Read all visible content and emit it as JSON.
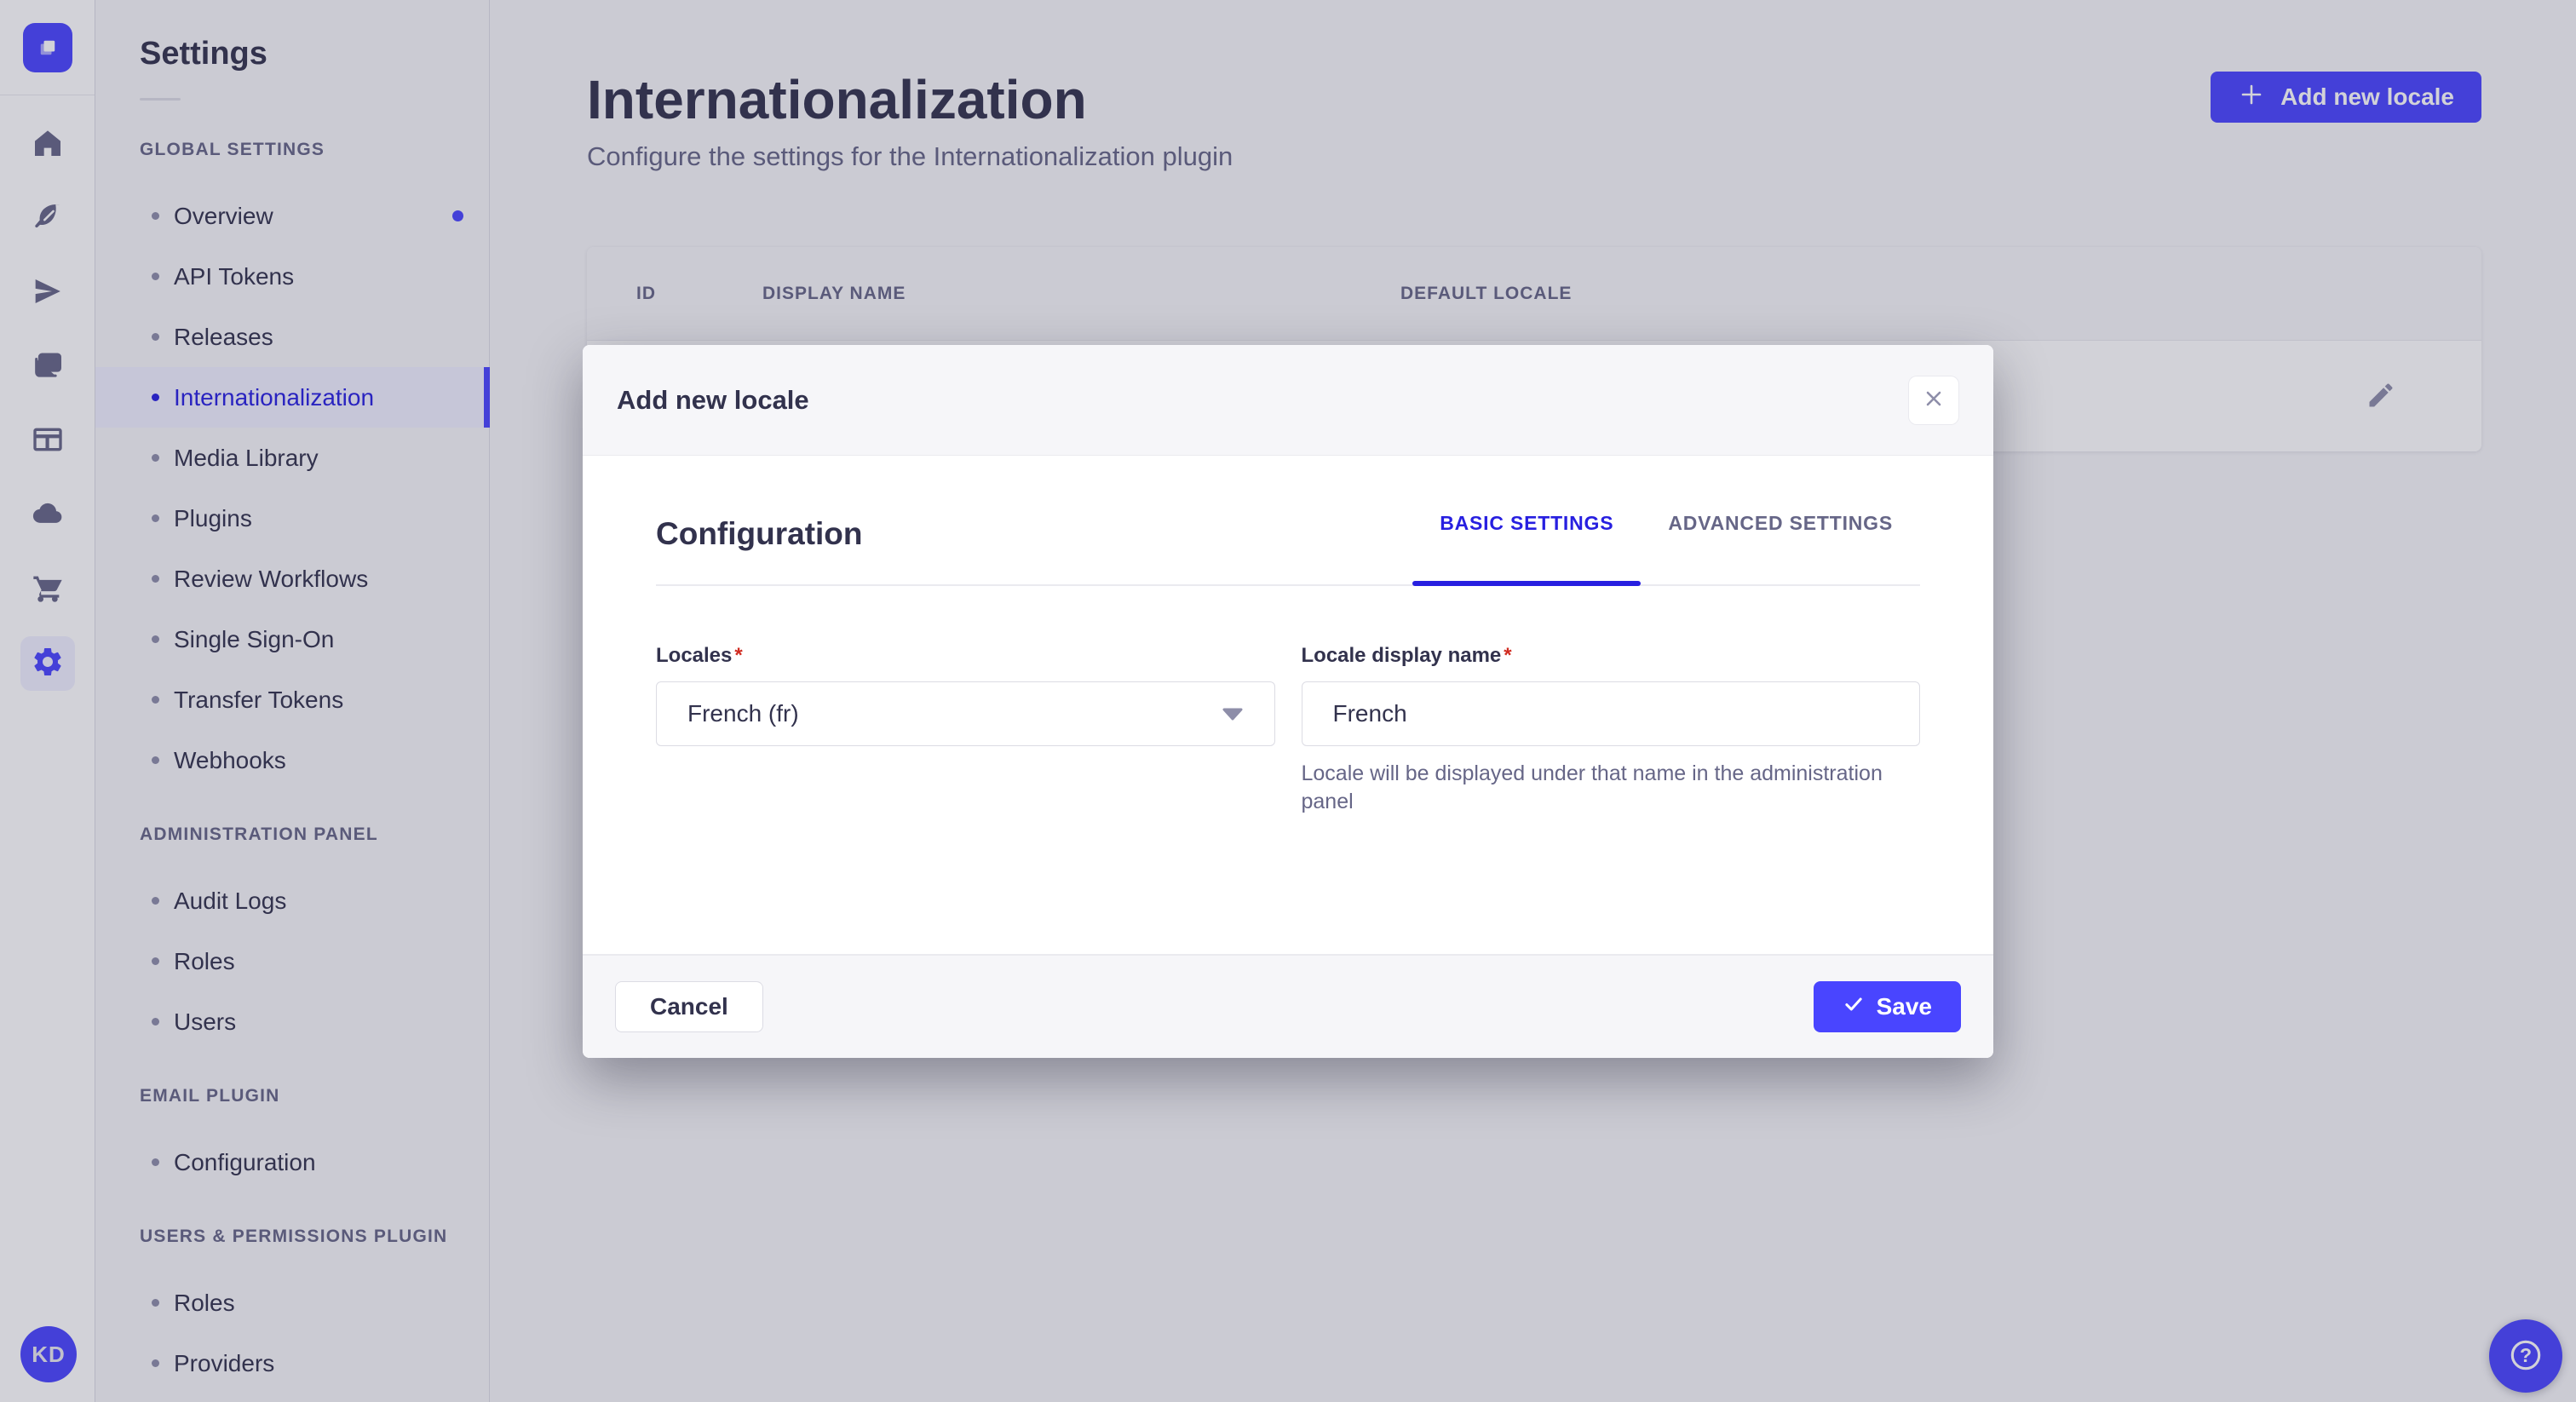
{
  "colors": {
    "primary": "#4945ff",
    "primary_dark": "#271fe0",
    "primary_light_bg": "#f0f0ff",
    "text": "#32324d",
    "text_muted": "#666687",
    "border": "#dcdce4",
    "border_light": "#eaeaef",
    "page_bg": "#f6f6f9",
    "danger": "#d02b20"
  },
  "rail": {
    "logo_icon": "strapi-logo-icon",
    "items": [
      {
        "icon": "home-icon",
        "active": false
      },
      {
        "icon": "feather-icon",
        "active": false
      },
      {
        "icon": "paper-plane-icon",
        "active": false
      },
      {
        "icon": "media-library-icon",
        "active": false
      },
      {
        "icon": "layout-icon",
        "active": false
      },
      {
        "icon": "cloud-icon",
        "active": false
      },
      {
        "icon": "cart-icon",
        "active": false
      },
      {
        "icon": "gear-icon",
        "active": true
      }
    ],
    "avatar_initials": "KD"
  },
  "sidebar": {
    "title": "Settings",
    "sections": [
      {
        "label": "GLOBAL SETTINGS",
        "items": [
          {
            "label": "Overview",
            "notification": true
          },
          {
            "label": "API Tokens"
          },
          {
            "label": "Releases"
          },
          {
            "label": "Internationalization",
            "active": true
          },
          {
            "label": "Media Library"
          },
          {
            "label": "Plugins"
          },
          {
            "label": "Review Workflows"
          },
          {
            "label": "Single Sign-On"
          },
          {
            "label": "Transfer Tokens"
          },
          {
            "label": "Webhooks"
          }
        ]
      },
      {
        "label": "ADMINISTRATION PANEL",
        "items": [
          {
            "label": "Audit Logs"
          },
          {
            "label": "Roles"
          },
          {
            "label": "Users"
          }
        ]
      },
      {
        "label": "EMAIL PLUGIN",
        "items": [
          {
            "label": "Configuration"
          }
        ]
      },
      {
        "label": "USERS & PERMISSIONS PLUGIN",
        "items": [
          {
            "label": "Roles"
          },
          {
            "label": "Providers"
          }
        ]
      }
    ]
  },
  "main": {
    "title": "Internationalization",
    "subtitle": "Configure the settings for the Internationalization plugin",
    "add_button_label": "Add new locale",
    "table": {
      "columns": [
        "ID",
        "DISPLAY NAME",
        "DEFAULT LOCALE"
      ],
      "row_action_icon": "pencil-icon"
    }
  },
  "modal": {
    "title": "Add new locale",
    "close_icon": "close-icon",
    "section_title": "Configuration",
    "tabs": [
      {
        "label": "BASIC SETTINGS",
        "active": true
      },
      {
        "label": "ADVANCED SETTINGS",
        "active": false
      }
    ],
    "required_mark": "*",
    "locales_field": {
      "label": "Locales",
      "value": "French (fr)",
      "caret_icon": "chevron-down-icon"
    },
    "display_name_field": {
      "label": "Locale display name",
      "value": "French",
      "hint": "Locale will be displayed under that name in the administration panel"
    },
    "cancel_label": "Cancel",
    "save_label": "Save",
    "save_icon": "check-icon"
  },
  "help_fab": {
    "icon": "question-mark-icon"
  }
}
